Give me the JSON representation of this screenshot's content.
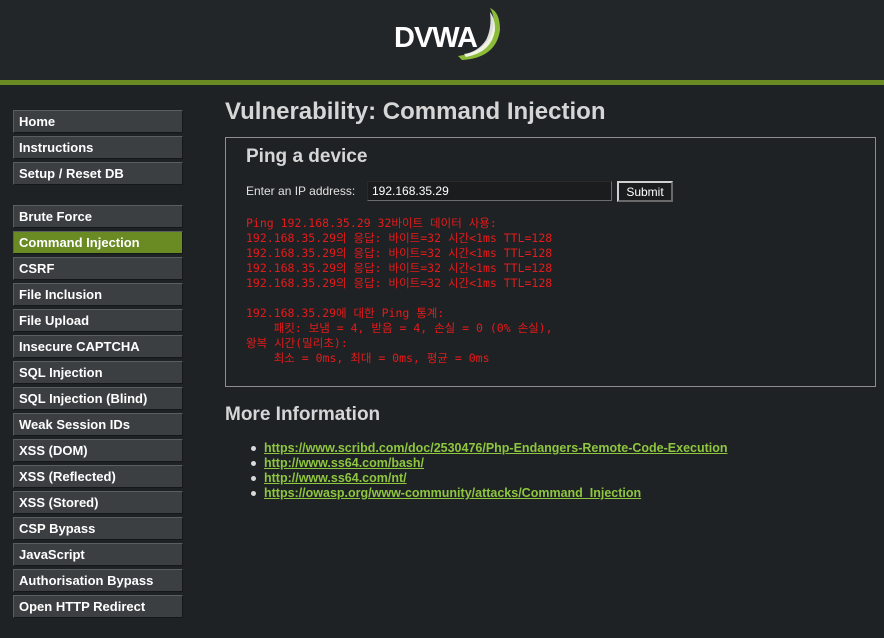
{
  "header": {
    "logo_text": "DVWA"
  },
  "sidebar": {
    "groups": [
      [
        {
          "label": "Home"
        },
        {
          "label": "Instructions"
        },
        {
          "label": "Setup / Reset DB"
        }
      ],
      [
        {
          "label": "Brute Force"
        },
        {
          "label": "Command Injection",
          "active": true
        },
        {
          "label": "CSRF"
        },
        {
          "label": "File Inclusion"
        },
        {
          "label": "File Upload"
        },
        {
          "label": "Insecure CAPTCHA"
        },
        {
          "label": "SQL Injection"
        },
        {
          "label": "SQL Injection (Blind)"
        },
        {
          "label": "Weak Session IDs"
        },
        {
          "label": "XSS (DOM)"
        },
        {
          "label": "XSS (Reflected)"
        },
        {
          "label": "XSS (Stored)"
        },
        {
          "label": "CSP Bypass"
        },
        {
          "label": "JavaScript"
        },
        {
          "label": "Authorisation Bypass"
        },
        {
          "label": "Open HTTP Redirect"
        }
      ]
    ]
  },
  "main": {
    "title": "Vulnerability: Command Injection",
    "form": {
      "heading": "Ping a device",
      "ip_label": "Enter an IP address:",
      "ip_value": "192.168.35.29",
      "submit_label": "Submit"
    },
    "output": "Ping 192.168.35.29 32바이트 데이터 사용:\n192.168.35.29의 응답: 바이트=32 시간<1ms TTL=128\n192.168.35.29의 응답: 바이트=32 시간<1ms TTL=128\n192.168.35.29의 응답: 바이트=32 시간<1ms TTL=128\n192.168.35.29의 응답: 바이트=32 시간<1ms TTL=128\n\n192.168.35.29에 대한 Ping 통계:\n    패킷: 보냄 = 4, 받음 = 4, 손실 = 0 (0% 손실),\n왕복 시간(밀리초):\n    최소 = 0ms, 최대 = 0ms, 평균 = 0ms",
    "more_info": {
      "title": "More Information",
      "links": [
        "https://www.scribd.com/doc/2530476/Php-Endangers-Remote-Code-Execution",
        "http://www.ss64.com/bash/",
        "http://www.ss64.com/nt/",
        "https://owasp.org/www-community/attacks/Command_Injection"
      ]
    }
  },
  "colors": {
    "accent_green": "#6a8a24",
    "link_green": "#8ec63f",
    "output_red": "#e61a1a",
    "background": "#1f2224"
  }
}
